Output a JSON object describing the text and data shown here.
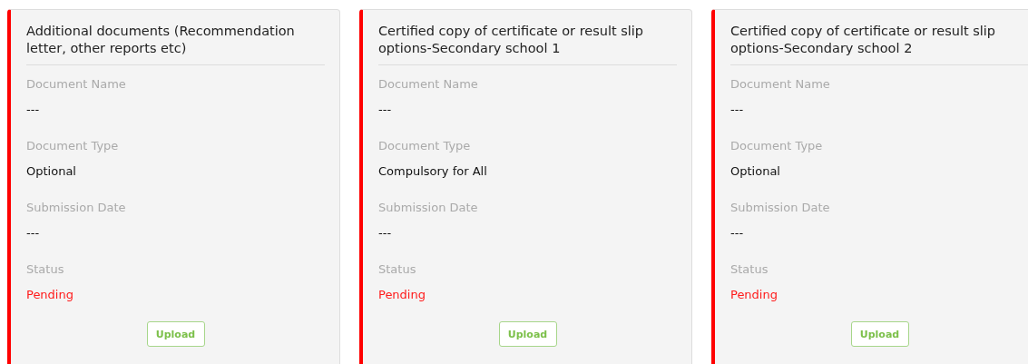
{
  "cards": [
    {
      "title": "Additional documents (Recommendation letter, other reports etc)",
      "fields": [
        {
          "label": "Document Name",
          "value": "---",
          "kind": "text"
        },
        {
          "label": "Document Type",
          "value": "Optional",
          "kind": "text"
        },
        {
          "label": "Submission Date",
          "value": "---",
          "kind": "text"
        },
        {
          "label": "Status",
          "value": "Pending",
          "kind": "status"
        }
      ],
      "button": "Upload"
    },
    {
      "title": "Certified copy of certificate or result slip options-Secondary school 1",
      "fields": [
        {
          "label": "Document Name",
          "value": "---",
          "kind": "text"
        },
        {
          "label": "Document Type",
          "value": "Compulsory for All",
          "kind": "text"
        },
        {
          "label": "Submission Date",
          "value": "---",
          "kind": "text"
        },
        {
          "label": "Status",
          "value": "Pending",
          "kind": "status"
        }
      ],
      "button": "Upload"
    },
    {
      "title": "Certified copy of certificate or result slip options-Secondary school 2",
      "fields": [
        {
          "label": "Document Name",
          "value": "---",
          "kind": "text"
        },
        {
          "label": "Document Type",
          "value": "Optional",
          "kind": "text"
        },
        {
          "label": "Submission Date",
          "value": "---",
          "kind": "text"
        },
        {
          "label": "Status",
          "value": "Pending",
          "kind": "status"
        }
      ],
      "button": "Upload"
    }
  ]
}
